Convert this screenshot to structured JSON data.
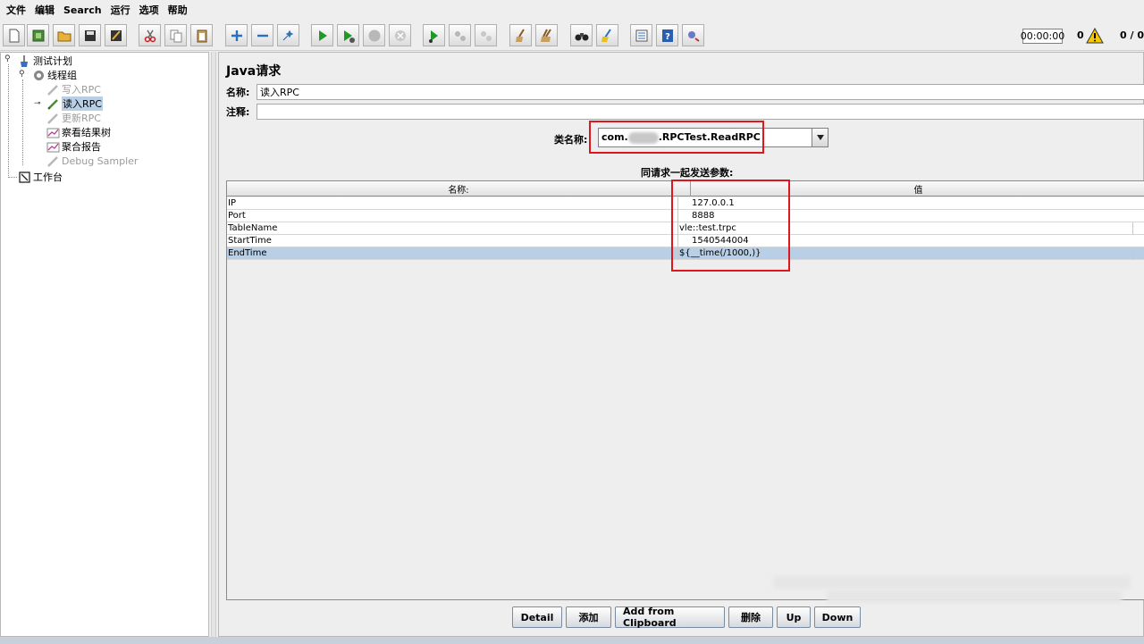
{
  "menubar": {
    "items": [
      "文件",
      "编辑",
      "Search",
      "运行",
      "选项",
      "帮助"
    ]
  },
  "toolbar": {
    "buttons": [
      "new",
      "templates",
      "open",
      "save",
      "save-screenshot",
      "cut",
      "copy",
      "paste",
      "expand",
      "collapse",
      "toggle",
      "start",
      "start-no-pause",
      "stop",
      "shutdown",
      "remote-start",
      "remote-stop",
      "remote-shutdown",
      "clear",
      "clear-all",
      "search",
      "reset-search",
      "function-helper",
      "help",
      "remote-exit"
    ],
    "timer": "00:00:00",
    "error_count": "0",
    "thread_ratio": "0 / 0"
  },
  "tree": {
    "items": [
      {
        "label": "测试计划",
        "icon": "test-plan-icon",
        "state": "normal"
      },
      {
        "label": "线程组",
        "icon": "thread-group-icon",
        "state": "normal"
      },
      {
        "label": "写入RPC",
        "icon": "sampler-icon",
        "state": "disabled"
      },
      {
        "label": "读入RPC",
        "icon": "sampler-icon",
        "state": "selected"
      },
      {
        "label": "更新RPC",
        "icon": "sampler-icon",
        "state": "disabled"
      },
      {
        "label": "察看结果树",
        "icon": "listener-icon",
        "state": "normal"
      },
      {
        "label": "聚合报告",
        "icon": "listener-icon",
        "state": "normal"
      },
      {
        "label": "Debug Sampler",
        "icon": "sampler-icon",
        "state": "disabled"
      },
      {
        "label": "工作台",
        "icon": "workbench-icon",
        "state": "normal"
      }
    ]
  },
  "panel": {
    "title": "Java请求",
    "name_label": "名称:",
    "name_value": "读入RPC",
    "comment_label": "注释:",
    "comment_value": "",
    "classname_label": "类名称:",
    "classname_prefix": "com.",
    "classname_suffix": ".RPCTest.ReadRPC",
    "params_title": "同请求一起发送参数:",
    "columns": [
      "名称:",
      "值"
    ],
    "rows": [
      {
        "name": "IP",
        "value": "127.0.0.1"
      },
      {
        "name": "Port",
        "value": "8888"
      },
      {
        "name": "TableName",
        "value": "vle::test.trpc"
      },
      {
        "name": "StartTime",
        "value": "1540544004"
      },
      {
        "name": "EndTime",
        "value": "${__time(/1000,)}"
      }
    ],
    "buttons": [
      "Detail",
      "添加",
      "Add from Clipboard",
      "删除",
      "Up",
      "Down"
    ]
  },
  "colors": {
    "selection": "#b8cfe5",
    "highlight_box": "#e0161c",
    "panel_bg": "#eeeeee"
  }
}
